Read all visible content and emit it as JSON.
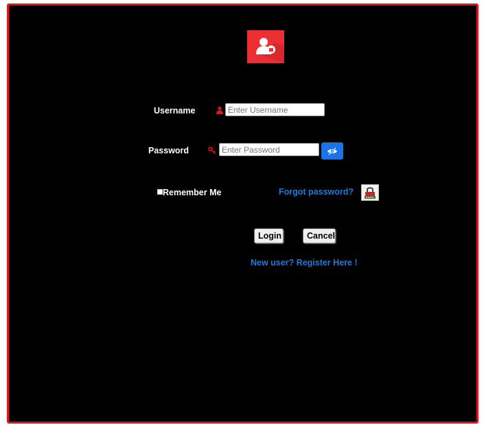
{
  "colors": {
    "frame_border": "#e3161b",
    "background": "#000000",
    "accent_red": "#ec2f35",
    "link_blue": "#1e7bd9",
    "toggle_blue": "#1a73e8"
  },
  "header": {
    "logo_icon": "user-lock-icon"
  },
  "form": {
    "username": {
      "label": "Username",
      "icon": "user-icon",
      "placeholder": "Enter Username",
      "value": ""
    },
    "password": {
      "label": "Password",
      "icon": "key-icon",
      "placeholder": "Enter Password",
      "value": "",
      "toggle_icon": "eye-slash-icon"
    },
    "remember_me": {
      "label": "Remember Me",
      "checked": false
    },
    "forgot_password": {
      "label": "Forgot password?",
      "icon": "lock-icon"
    },
    "buttons": {
      "login": "Login",
      "cancel": "Cancel"
    },
    "register_link": "New user? Register Here !"
  }
}
